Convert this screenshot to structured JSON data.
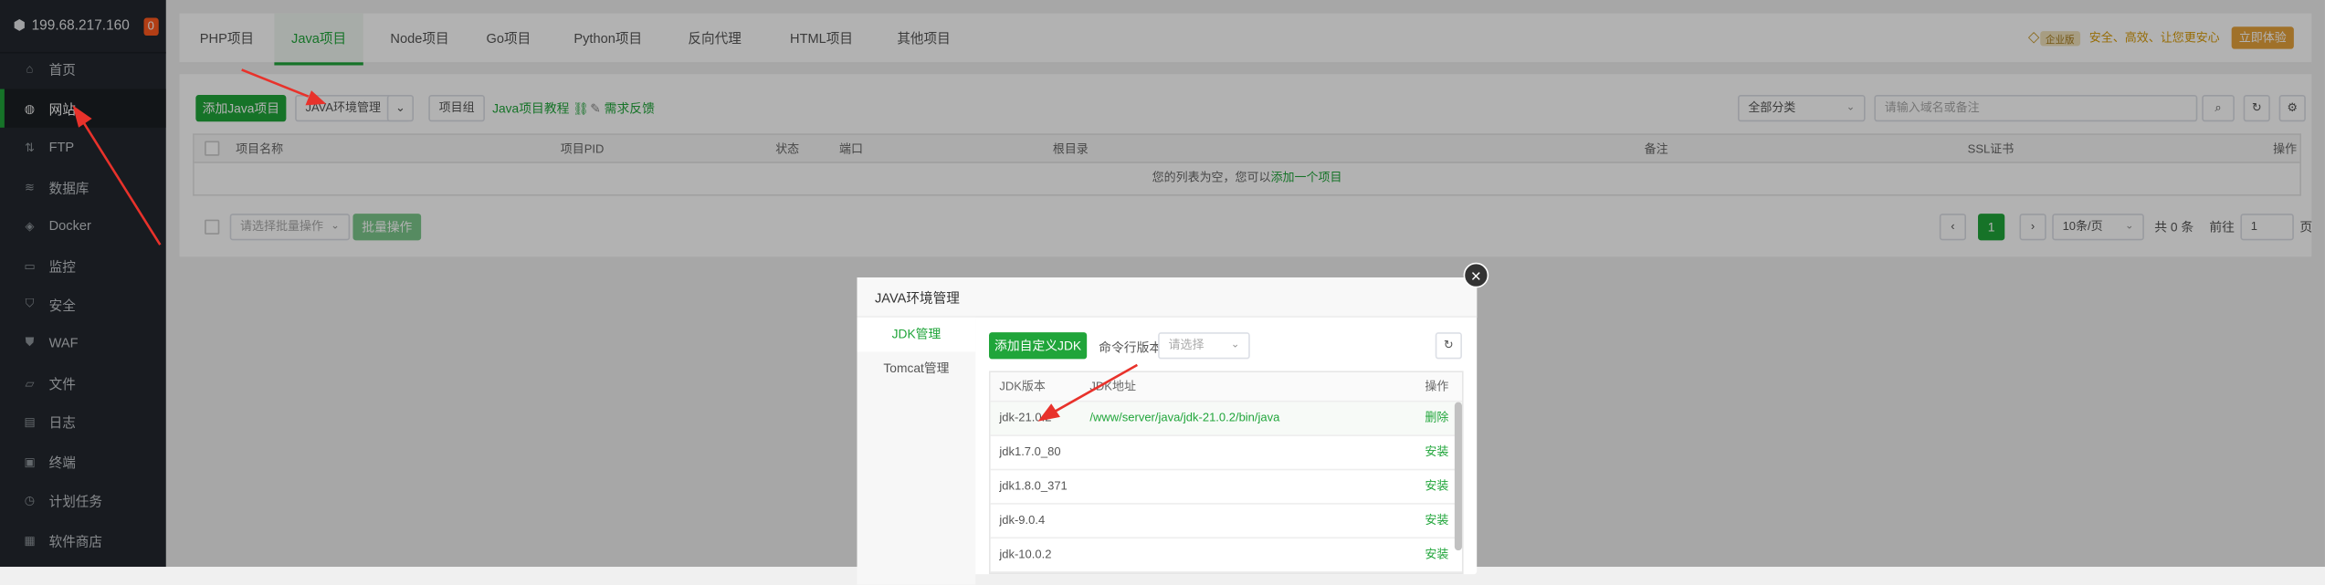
{
  "server": {
    "ip": "199.68.217.160",
    "badge": "0"
  },
  "sidebar": {
    "items": [
      {
        "label": "首页",
        "icon": "home-icon"
      },
      {
        "label": "网站",
        "icon": "globe-icon"
      },
      {
        "label": "FTP",
        "icon": "ftp-icon"
      },
      {
        "label": "数据库",
        "icon": "database-icon"
      },
      {
        "label": "Docker",
        "icon": "docker-icon"
      },
      {
        "label": "监控",
        "icon": "monitor-icon"
      },
      {
        "label": "安全",
        "icon": "shield-icon"
      },
      {
        "label": "WAF",
        "icon": "waf-shield-icon"
      },
      {
        "label": "文件",
        "icon": "folder-icon"
      },
      {
        "label": "日志",
        "icon": "log-icon"
      },
      {
        "label": "终端",
        "icon": "terminal-icon"
      },
      {
        "label": "计划任务",
        "icon": "clock-icon"
      },
      {
        "label": "软件商店",
        "icon": "grid-icon"
      }
    ]
  },
  "tabs": [
    "PHP项目",
    "Java项目",
    "Node项目",
    "Go项目",
    "Python项目",
    "反向代理",
    "HTML项目",
    "其他项目"
  ],
  "pro": {
    "level": "企业版",
    "slogan": "安全、高效、让您更安心",
    "button": "立即体验"
  },
  "toolbar": {
    "add_java": "添加Java项目",
    "java_env": "JAVA环境管理",
    "project_group": "项目组",
    "tutorial": "Java项目教程",
    "feedback": "需求反馈",
    "category": "全部分类",
    "search_placeholder": "请输入域名或备注"
  },
  "table": {
    "headers": [
      "项目名称",
      "项目PID",
      "状态",
      "端口",
      "根目录",
      "备注",
      "SSL证书",
      "操作"
    ],
    "empty_text": "您的列表为空，您可以",
    "empty_link": "添加一个项目"
  },
  "footer": {
    "batch_placeholder": "请选择批量操作",
    "batch_button": "批量操作",
    "page_current": "1",
    "page_size": "10条/页",
    "total": "共 0 条",
    "goto_label": "前往",
    "goto_value": "1",
    "page_unit": "页"
  },
  "modal": {
    "title": "JAVA环境管理",
    "side": [
      "JDK管理",
      "Tomcat管理"
    ],
    "add_jdk": "添加自定义JDK",
    "cmd_version_label": "命令行版本",
    "cmd_version_placeholder": "请选择",
    "jdk_table": {
      "headers": [
        "JDK版本",
        "JDK地址",
        "操作"
      ],
      "rows": [
        {
          "version": "jdk-21.0.2",
          "path": "/www/server/java/jdk-21.0.2/bin/java",
          "action": "删除"
        },
        {
          "version": "jdk1.7.0_80",
          "path": "",
          "action": "安装"
        },
        {
          "version": "jdk1.8.0_371",
          "path": "",
          "action": "安装"
        },
        {
          "version": "jdk-9.0.4",
          "path": "",
          "action": "安装"
        },
        {
          "version": "jdk-10.0.2",
          "path": "",
          "action": "安装"
        }
      ]
    }
  },
  "colors": {
    "accent": "#20a53a",
    "sidebar_bg": "#23282e",
    "annotation_arrow": "#e8322b"
  }
}
